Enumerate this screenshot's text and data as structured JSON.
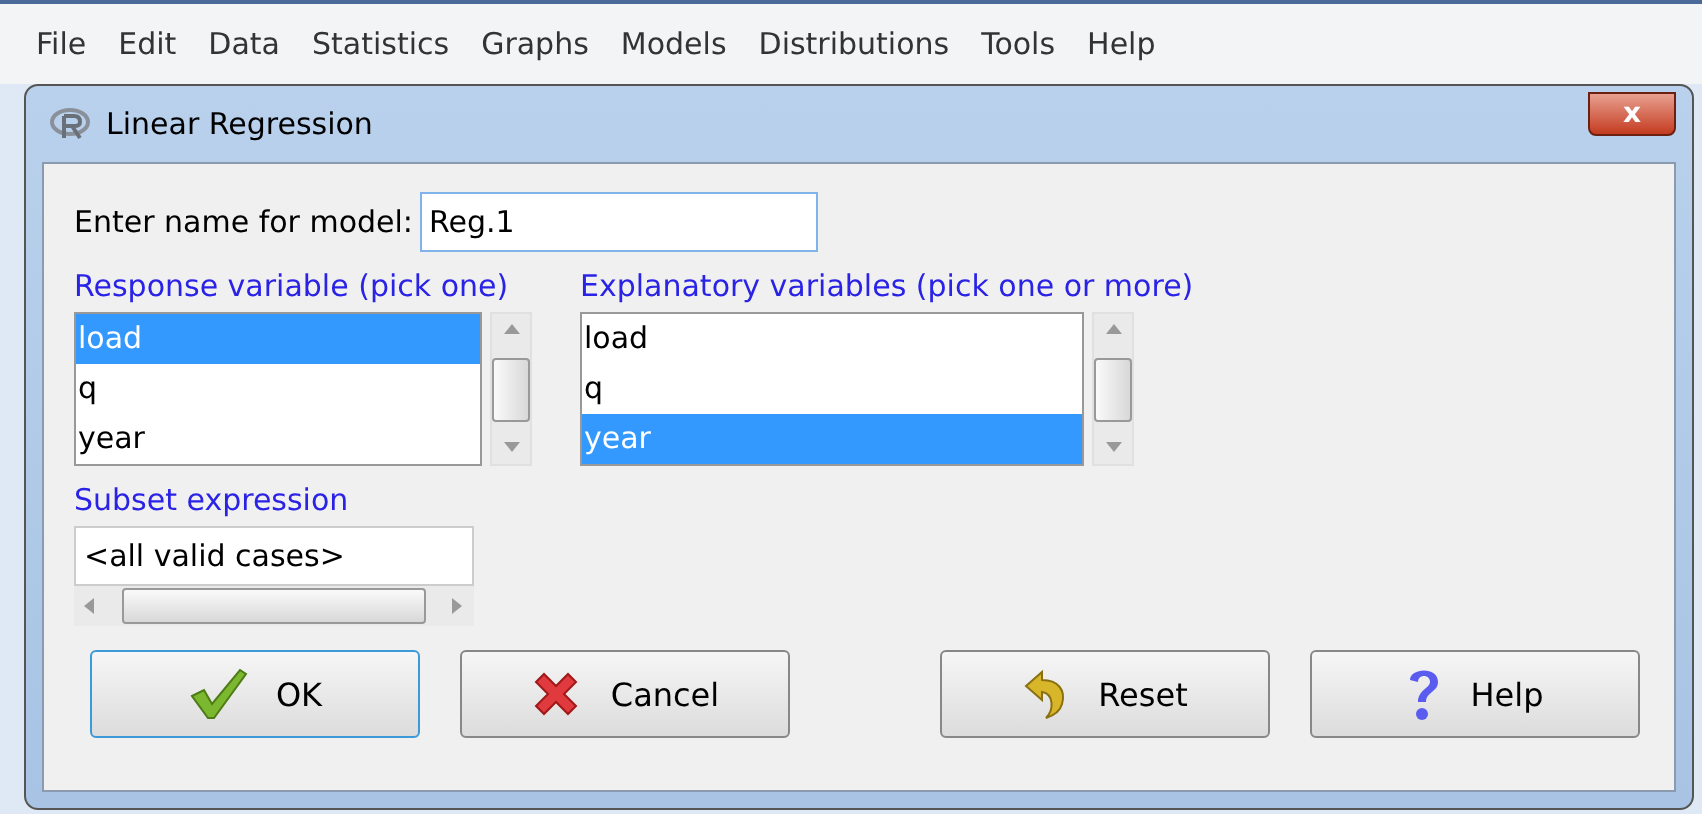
{
  "menu_bar": [
    "File",
    "Edit",
    "Data",
    "Statistics",
    "Graphs",
    "Models",
    "Distributions",
    "Tools",
    "Help"
  ],
  "window": {
    "title": "Linear Regression",
    "close": "x"
  },
  "model_name": {
    "label": "Enter name for model:",
    "value": "Reg.1"
  },
  "response": {
    "label": "Response variable (pick one)",
    "items": [
      {
        "text": "load",
        "selected": true
      },
      {
        "text": "q",
        "selected": false
      },
      {
        "text": "year",
        "selected": false
      }
    ]
  },
  "explanatory": {
    "label": "Explanatory variables (pick one or more)",
    "items": [
      {
        "text": "load",
        "selected": false
      },
      {
        "text": "q",
        "selected": false
      },
      {
        "text": "year",
        "selected": true
      }
    ]
  },
  "subset": {
    "label": "Subset expression",
    "value": "<all valid cases>"
  },
  "buttons": [
    {
      "kind": "ok",
      "label": "OK",
      "focused": true
    },
    {
      "kind": "cancel",
      "label": "Cancel",
      "focused": false
    },
    {
      "kind": "reset",
      "label": "Reset",
      "focused": false
    },
    {
      "kind": "help",
      "label": "Help",
      "focused": false
    }
  ]
}
